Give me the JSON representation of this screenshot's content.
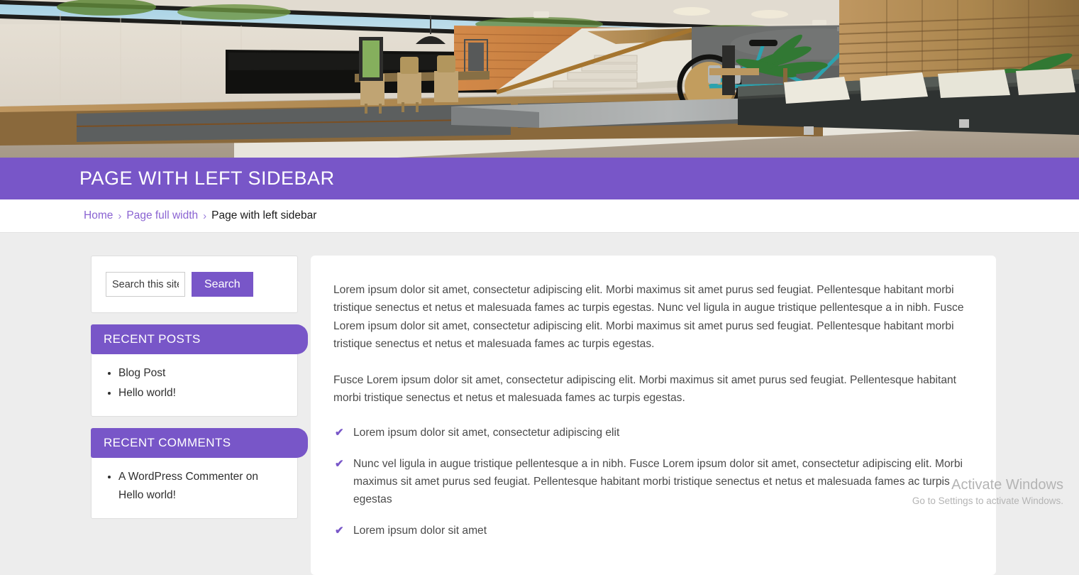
{
  "hero": {
    "alt": "modern interior living room render with sofa, bicycle and staircase"
  },
  "header": {
    "title": "Page with left sidebar"
  },
  "breadcrumb": {
    "items": [
      {
        "label": "Home",
        "current": false
      },
      {
        "label": "Page full width",
        "current": false
      },
      {
        "label": "Page with left sidebar",
        "current": true
      }
    ],
    "separator": "›"
  },
  "sidebar": {
    "search": {
      "placeholder": "Search this site",
      "value": "",
      "button_label": "Search"
    },
    "widgets": [
      {
        "title": "Recent Posts",
        "type": "list",
        "items": [
          {
            "text": "Blog Post"
          },
          {
            "text": "Hello world!"
          }
        ]
      },
      {
        "title": "Recent Comments",
        "type": "comments",
        "items": [
          {
            "author": "A WordPress Commenter",
            "connector": "on",
            "post": "Hello world!"
          }
        ]
      }
    ]
  },
  "main": {
    "paragraphs": [
      "Lorem ipsum dolor sit amet, consectetur adipiscing elit. Morbi maximus sit amet purus sed feugiat. Pellentesque habitant morbi tristique senectus et netus et malesuada fames ac turpis egestas. Nunc vel ligula in augue tristique pellentesque a in nibh. Fusce Lorem ipsum dolor sit amet, consectetur adipiscing elit. Morbi maximus sit amet purus sed feugiat. Pellentesque habitant morbi tristique senectus et netus et malesuada fames ac turpis egestas.",
      "Fusce Lorem ipsum dolor sit amet, consectetur adipiscing elit. Morbi maximus sit amet purus sed feugiat. Pellentesque habitant morbi tristique senectus et netus et malesuada fames ac turpis egestas."
    ],
    "check_items": [
      "Lorem ipsum dolor sit amet, consectetur adipiscing elit",
      "Nunc vel ligula in augue tristique pellentesque a in nibh. Fusce Lorem ipsum dolor sit amet, consectetur adipiscing elit. Morbi maximus sit amet purus sed feugiat. Pellentesque habitant morbi tristique senectus et netus et malesuada fames ac turpis egestas",
      "Lorem ipsum dolor sit amet"
    ],
    "check_glyph": "✔"
  },
  "watermark": {
    "title": "Activate Windows",
    "subtitle": "Go to Settings to activate Windows."
  },
  "colors": {
    "accent": "#7856c8",
    "page_bg": "#ededed",
    "card_bg": "#ffffff",
    "text": "#4a4a4a"
  }
}
